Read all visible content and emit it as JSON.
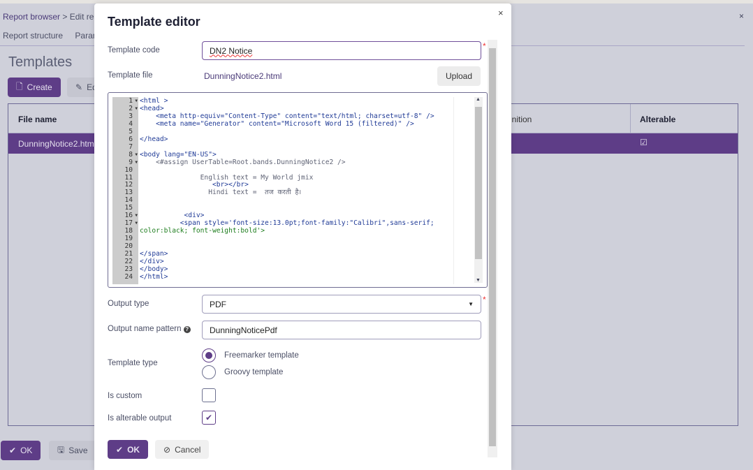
{
  "colors": {
    "accent": "#5e3d87",
    "required": "#e33333"
  },
  "background": {
    "breadcrumb": {
      "root": "Report browser",
      "separator": ">",
      "current": "Edit rep"
    },
    "tabs": [
      "Report structure",
      "Parame"
    ],
    "title": "Templates",
    "create_label": "Create",
    "edit_label": "Ed",
    "columns": {
      "file_name": "File name",
      "definition": "inition",
      "alterable": "Alterable"
    },
    "row": {
      "file_name": "DunningNotice2.htm",
      "alterable_check": "☑"
    },
    "ok_label": "OK",
    "save_label": "Save",
    "close_icon": "×"
  },
  "dialog": {
    "title": "Template editor",
    "close_icon": "×",
    "template_code": {
      "label": "Template code",
      "value": "DN2 Notice",
      "required": "*"
    },
    "template_file": {
      "label": "Template file",
      "value": "DunningNotice2.html",
      "upload_label": "Upload"
    },
    "editor": {
      "lines": [
        "<html >",
        "<head>",
        "    <meta http-equiv=\"Content-Type\" content=\"text/html; charset=utf-8\" />",
        "    <meta name=\"Generator\" content=\"Microsoft Word 15 (filtered)\" />",
        "",
        "</head>",
        "",
        "<body lang=\"EN-US\">",
        "    <#assign UserTable=Root.bands.DunningNotice2 />",
        "",
        "               English text = My World jmix",
        "                  <br></br>",
        "                 Hindi text =  तज करती है।",
        "",
        "",
        "           <div>",
        "          <span style='font-size:13.0pt;font-family:\"Calibri\",sans-serif;",
        "color:black; font-weight:bold'>",
        "",
        "",
        "</span>",
        "</div>",
        "</body>",
        "</html>"
      ],
      "foldable": [
        1,
        2,
        8,
        9,
        16,
        17
      ]
    },
    "output_type": {
      "label": "Output type",
      "value": "PDF",
      "required": "*"
    },
    "output_name_pattern": {
      "label": "Output name pattern",
      "value": "DunningNoticePdf",
      "help_icon": "?"
    },
    "template_type": {
      "label": "Template type",
      "options": [
        "Freemarker template",
        "Groovy template"
      ],
      "selected": "Freemarker template"
    },
    "is_custom": {
      "label": "Is custom",
      "checked": false
    },
    "is_alterable_output": {
      "label": "Is alterable output",
      "checked": true
    },
    "ok_label": "OK",
    "cancel_label": "Cancel"
  }
}
